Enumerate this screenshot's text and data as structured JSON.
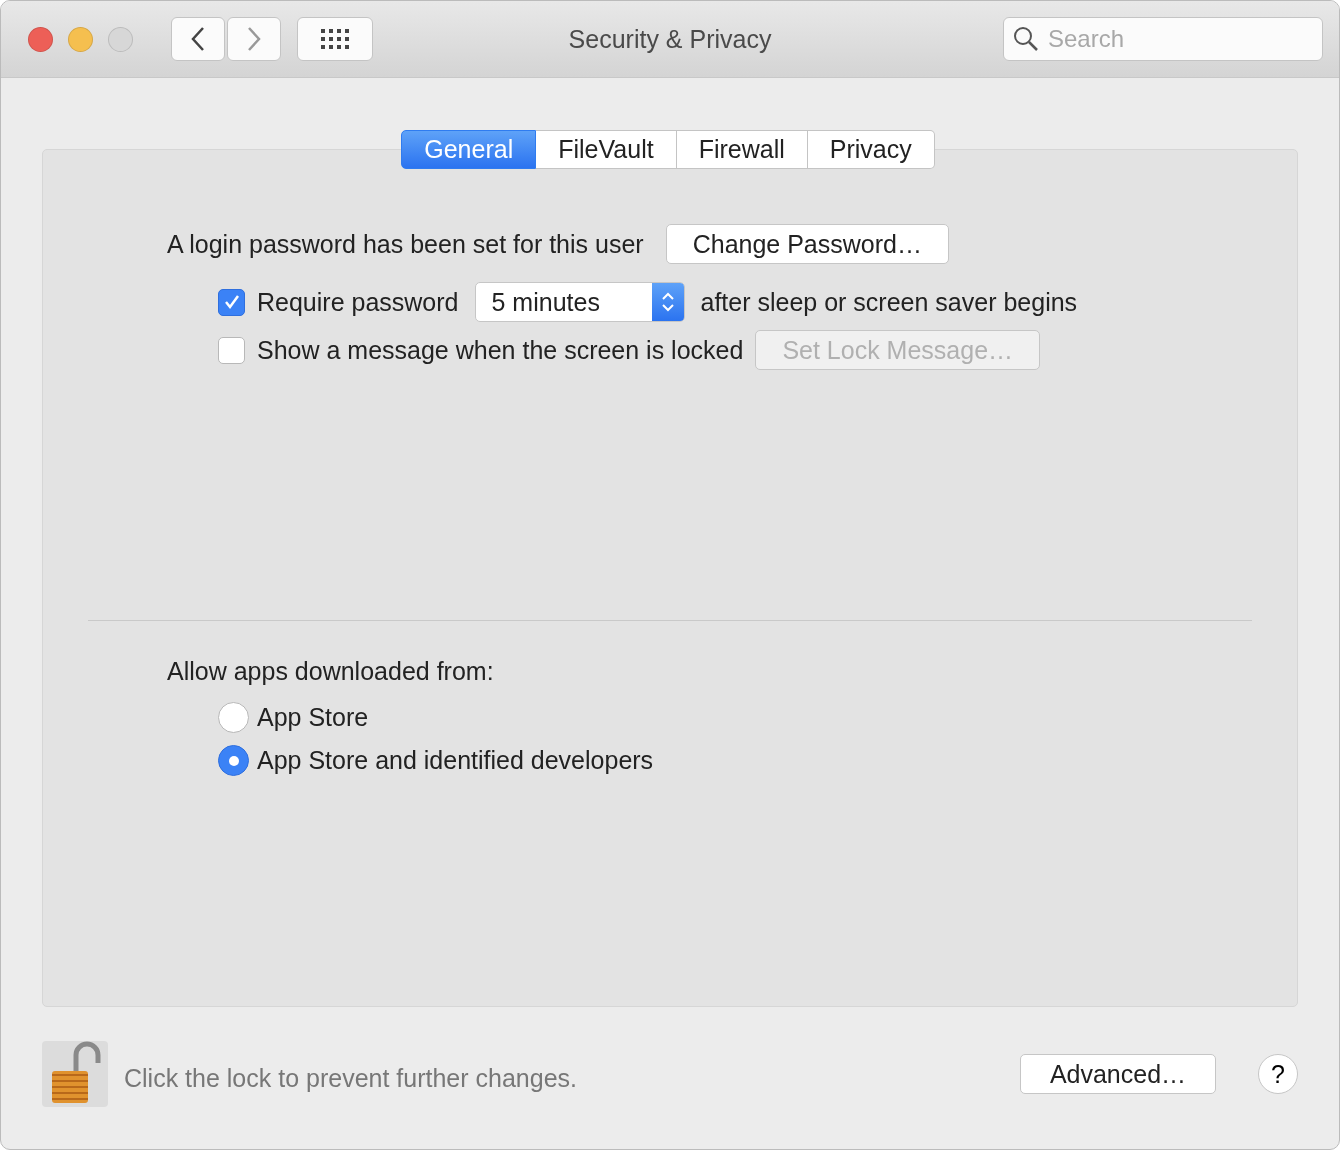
{
  "window": {
    "title": "Security & Privacy"
  },
  "search": {
    "placeholder": "Search"
  },
  "tabs": [
    {
      "label": "General",
      "selected": true
    },
    {
      "label": "FileVault",
      "selected": false
    },
    {
      "label": "Firewall",
      "selected": false
    },
    {
      "label": "Privacy",
      "selected": false
    }
  ],
  "password": {
    "label": "A login password has been set for this user",
    "button": "Change Password…"
  },
  "options": [
    {
      "kind": "select",
      "label": "Require password",
      "checked": true,
      "value": "5 minutes",
      "suffix": "after sleep or screen saver begins"
    },
    {
      "kind": "button",
      "label": "Show a message when the screen is locked",
      "checked": false,
      "button": "Set Lock Message…",
      "disabled": true
    }
  ],
  "downloads": {
    "heading": "Allow apps downloaded from:",
    "choices": [
      {
        "label": "App Store",
        "selected": false
      },
      {
        "label": "App Store and identified developers",
        "selected": true
      }
    ]
  },
  "footer": {
    "lock_text": "Click the lock to prevent further changes.",
    "advanced": "Advanced…",
    "help": "?"
  }
}
